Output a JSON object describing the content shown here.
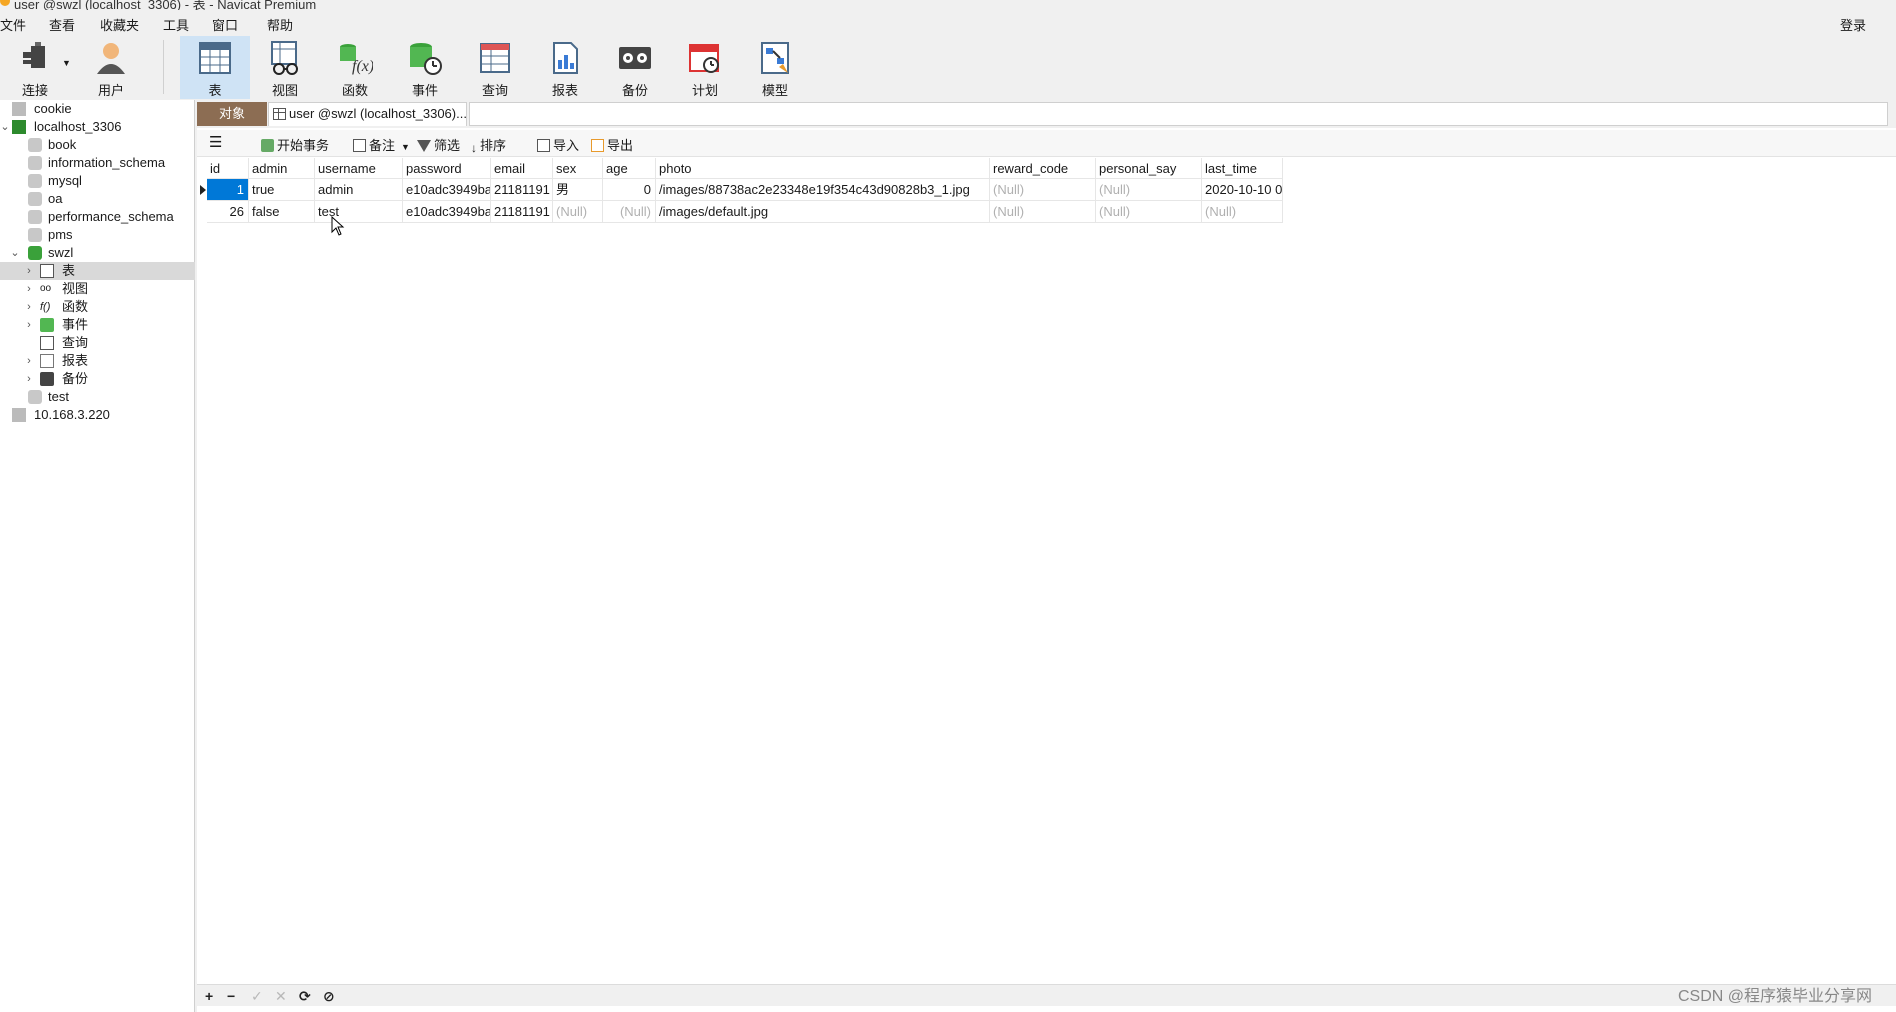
{
  "window": {
    "title": "user @swzl (localhost_3306) - 表 - Navicat Premium"
  },
  "menubar": {
    "items": [
      "文件",
      "查看",
      "收藏夹",
      "工具",
      "窗口",
      "帮助"
    ],
    "login": "登录"
  },
  "toolbar": {
    "connect": "连接",
    "user": "用户",
    "table": "表",
    "view": "视图",
    "function": "函数",
    "event": "事件",
    "query": "查询",
    "report": "报表",
    "backup": "备份",
    "schedule": "计划",
    "model": "模型"
  },
  "sidebar": {
    "items": [
      {
        "label": "cookie",
        "icon": "connection-gray-icon"
      },
      {
        "label": "localhost_3306",
        "icon": "connection-green-icon"
      },
      {
        "label": "book",
        "icon": "database-gray-icon"
      },
      {
        "label": "information_schema",
        "icon": "database-gray-icon"
      },
      {
        "label": "mysql",
        "icon": "database-gray-icon"
      },
      {
        "label": "oa",
        "icon": "database-gray-icon"
      },
      {
        "label": "performance_schema",
        "icon": "database-gray-icon"
      },
      {
        "label": "pms",
        "icon": "database-gray-icon"
      },
      {
        "label": "swzl",
        "icon": "database-green-icon"
      },
      {
        "label": "表",
        "icon": "table-icon"
      },
      {
        "label": "视图",
        "icon": "view-icon"
      },
      {
        "label": "函数",
        "icon": "function-icon"
      },
      {
        "label": "事件",
        "icon": "event-icon"
      },
      {
        "label": "查询",
        "icon": "query-icon"
      },
      {
        "label": "报表",
        "icon": "report-icon"
      },
      {
        "label": "备份",
        "icon": "backup-icon"
      },
      {
        "label": "test",
        "icon": "database-gray-icon"
      },
      {
        "label": "10.168.3.220",
        "icon": "connection-gray-icon"
      }
    ]
  },
  "tabs": {
    "object": "对象",
    "user_tab": "user @swzl (localhost_3306)..."
  },
  "subtoolbar": {
    "begin_transaction": "开始事务",
    "note": "备注",
    "filter": "筛选",
    "sort": "排序",
    "import": "导入",
    "export": "导出"
  },
  "grid": {
    "columns": [
      "id",
      "admin",
      "username",
      "password",
      "email",
      "sex",
      "age",
      "photo",
      "reward_code",
      "personal_say",
      "last_time"
    ],
    "rows": [
      [
        "1",
        "true",
        "admin",
        "e10adc3949ba",
        "21181191",
        "男",
        "0",
        "/images/88738ac2e23348e19f354c43d90828b3_1.jpg",
        "(Null)",
        "(Null)",
        "2020-10-10 0"
      ],
      [
        "26",
        "false",
        "test",
        "e10adc3949ba",
        "21181191",
        "(Null)",
        "(Null)",
        "/images/default.jpg",
        "(Null)",
        "(Null)",
        "(Null)"
      ]
    ]
  },
  "bottombar": {
    "add": "+",
    "remove": "−",
    "apply": "✓",
    "discard": "✕",
    "refresh": "⟳",
    "stop": "⊘"
  },
  "watermark": "CSDN @程序猿毕业分享网"
}
